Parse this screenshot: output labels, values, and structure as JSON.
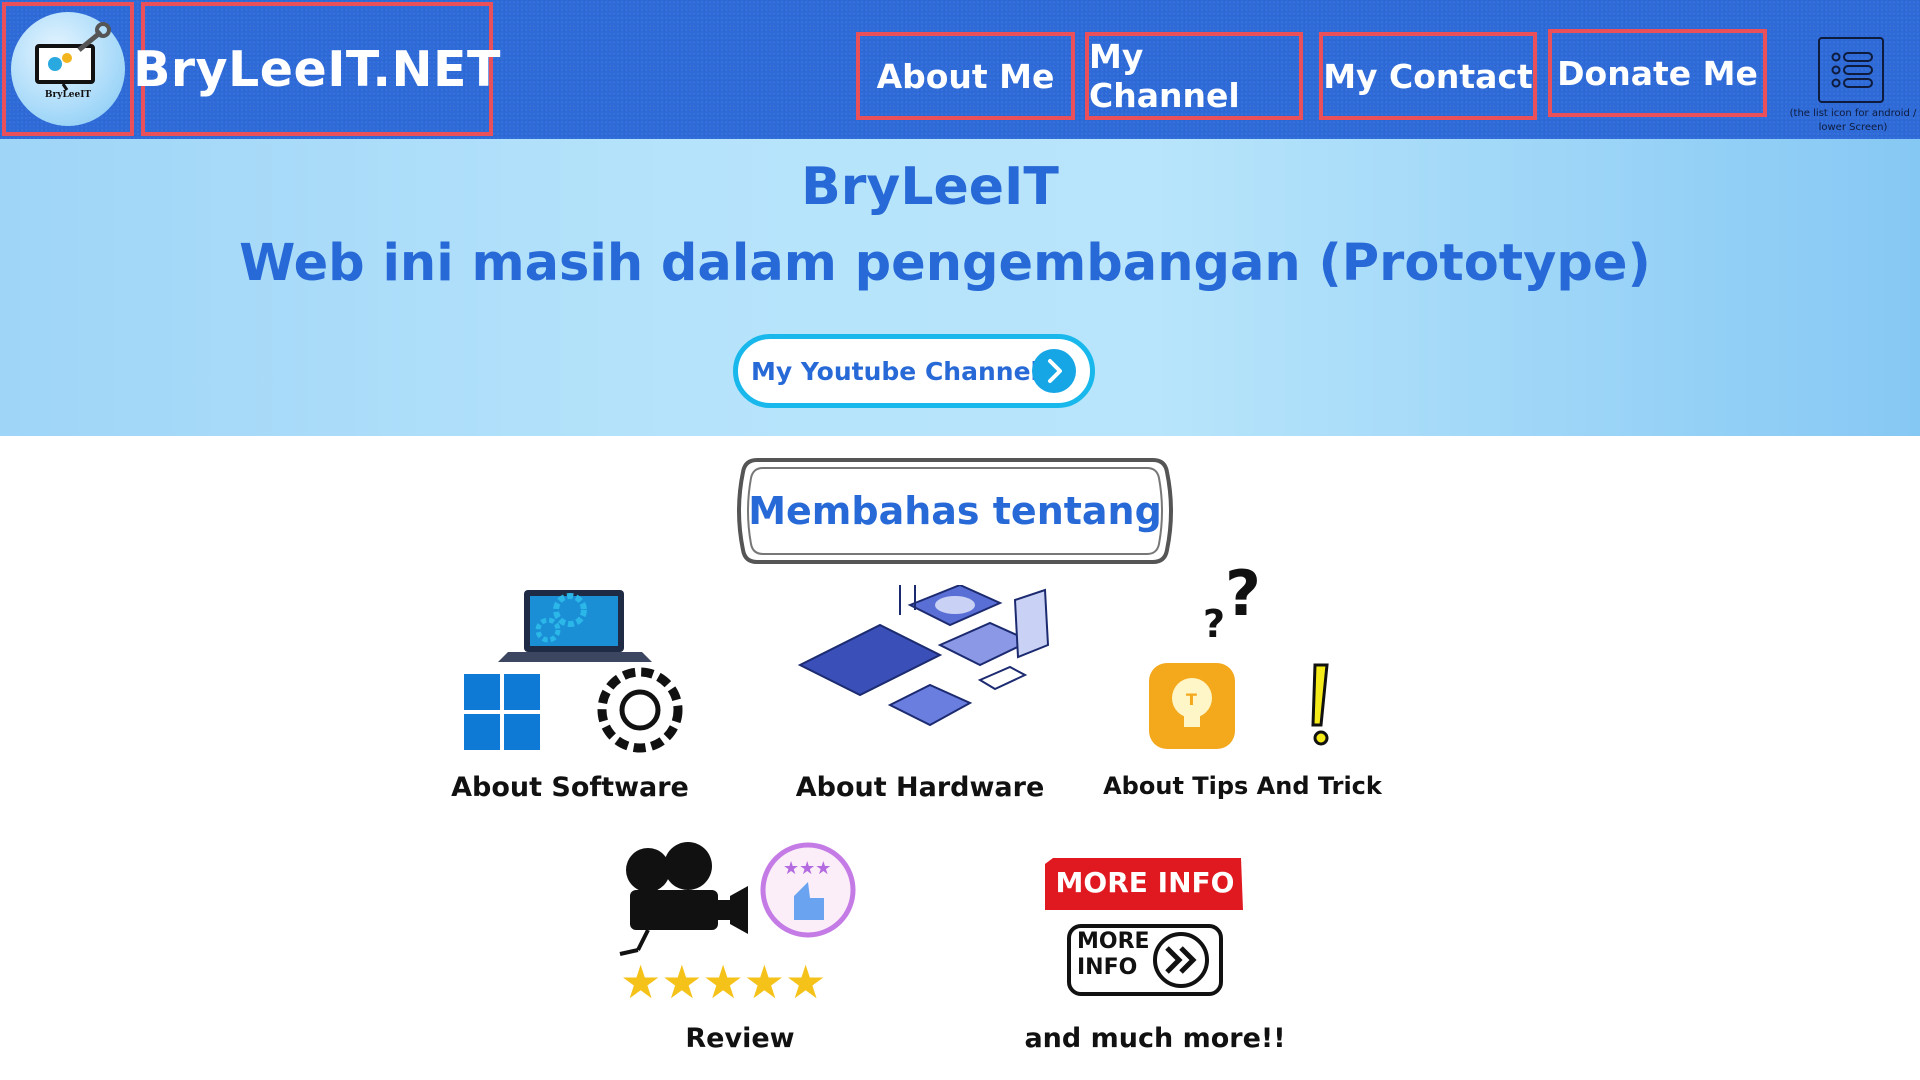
{
  "header": {
    "logo_caption": "BryLeeIT",
    "brand": "BryLeeIT.NET",
    "nav": [
      {
        "label": "About Me"
      },
      {
        "label": "My Channel"
      },
      {
        "label": "My Contact"
      },
      {
        "label": "Donate Me"
      }
    ],
    "menu_note": "(the list icon for android / lower Screen)",
    "menu_icon": "list-menu-icon"
  },
  "hero": {
    "title": "BryLeeIT",
    "subtitle": "Web ini masih dalam pengembangan (Prototype)",
    "button_label": "My Youtube Channel!",
    "button_icon": "chevron-right-icon"
  },
  "topics": {
    "heading": "Membahas tentang",
    "items": [
      {
        "label": "About Software",
        "icon": "software-icon"
      },
      {
        "label": "About Hardware",
        "icon": "hardware-icon"
      },
      {
        "label": "About Tips And Trick",
        "icon": "lightbulb-icon"
      },
      {
        "label": "Review",
        "icon": "movie-camera-icon"
      },
      {
        "label": "and much more!!",
        "icon": "more-info-icon"
      }
    ],
    "more_info_badge": "MORE INFO",
    "more_info_line1": "MORE",
    "more_info_line2": "INFO"
  },
  "colors": {
    "header_bg": "#2e6ad8",
    "highlight_border": "#e9505a",
    "accent_blue": "#2769d6",
    "button_border": "#18b8ec"
  }
}
